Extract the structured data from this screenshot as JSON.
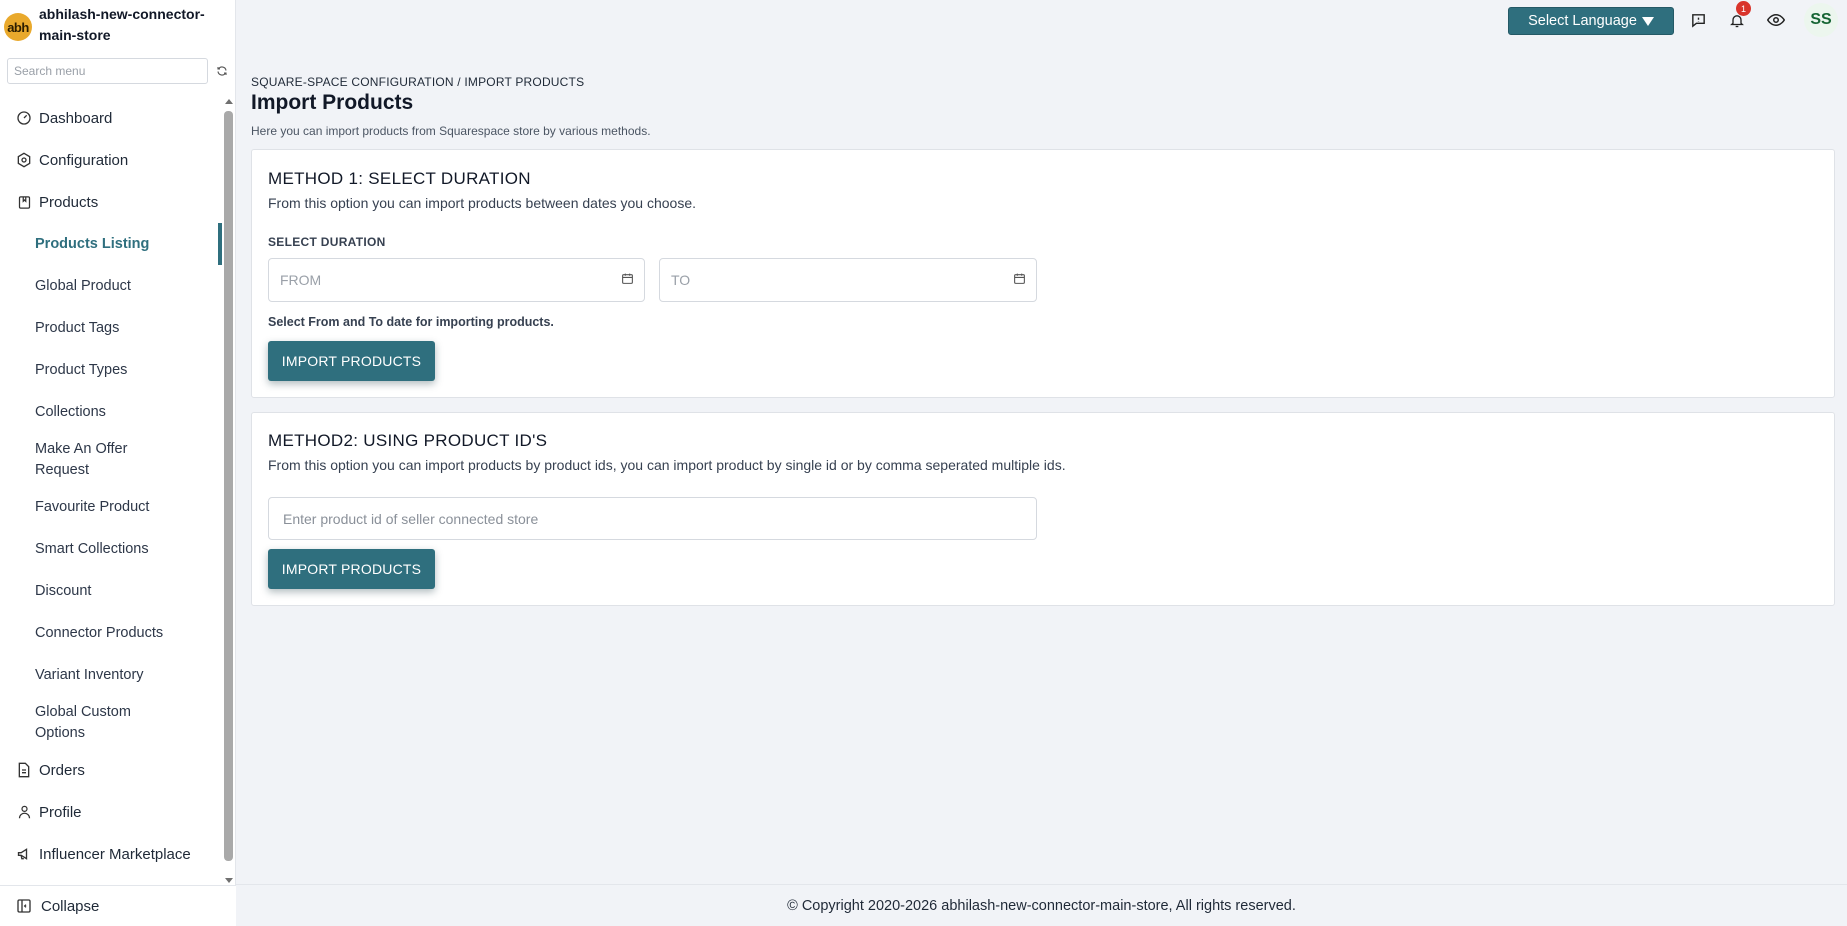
{
  "store": {
    "logo_text": "abh",
    "name": "abhilash-new-connector-main-store"
  },
  "sidebar": {
    "search_placeholder": "Search menu",
    "items": [
      {
        "label": "Dashboard",
        "icon": "dashboard-icon"
      },
      {
        "label": "Configuration",
        "icon": "gear-icon"
      },
      {
        "label": "Products",
        "icon": "bookmark-icon"
      }
    ],
    "product_subitems": [
      "Products Listing",
      "Global Product",
      "Product Tags",
      "Product Types",
      "Collections",
      "Make An Offer Request",
      "Favourite Product",
      "Smart Collections",
      "Discount",
      "Connector Products",
      "Variant Inventory",
      "Global Custom Options"
    ],
    "active_subitem": "Products Listing",
    "items_after": [
      {
        "label": "Orders",
        "icon": "document-icon"
      },
      {
        "label": "Profile",
        "icon": "user-icon"
      },
      {
        "label": "Influencer Marketplace",
        "icon": "megaphone-icon"
      }
    ],
    "collapse_label": "Collapse"
  },
  "topbar": {
    "language_label": "Select Language",
    "notification_count": "1",
    "avatar_initials": "SS"
  },
  "page": {
    "breadcrumb": "SQUARE-SPACE CONFIGURATION / IMPORT PRODUCTS",
    "title": "Import Products",
    "description": "Here you can import products from Squarespace store by various methods."
  },
  "method1": {
    "title": "METHOD 1: SELECT DURATION",
    "description": "From this option you can import products between dates you choose.",
    "field_label": "SELECT DURATION",
    "from_placeholder": "FROM",
    "to_placeholder": "TO",
    "hint": "Select From and To date for importing products.",
    "button_label": "IMPORT PRODUCTS"
  },
  "method2": {
    "title": "METHOD2: USING PRODUCT ID'S",
    "description": "From this option you can import products by product ids, you can import product by single id or by comma seperated multiple ids.",
    "input_placeholder": "Enter product id of seller connected store",
    "button_label": "IMPORT PRODUCTS"
  },
  "footer": {
    "copyright": "© Copyright 2020-2026 abhilash-new-connector-main-store, All rights reserved."
  },
  "colors": {
    "accent": "#2f6f7e",
    "logo": "#e9a92c",
    "badge": "#d9342b"
  }
}
